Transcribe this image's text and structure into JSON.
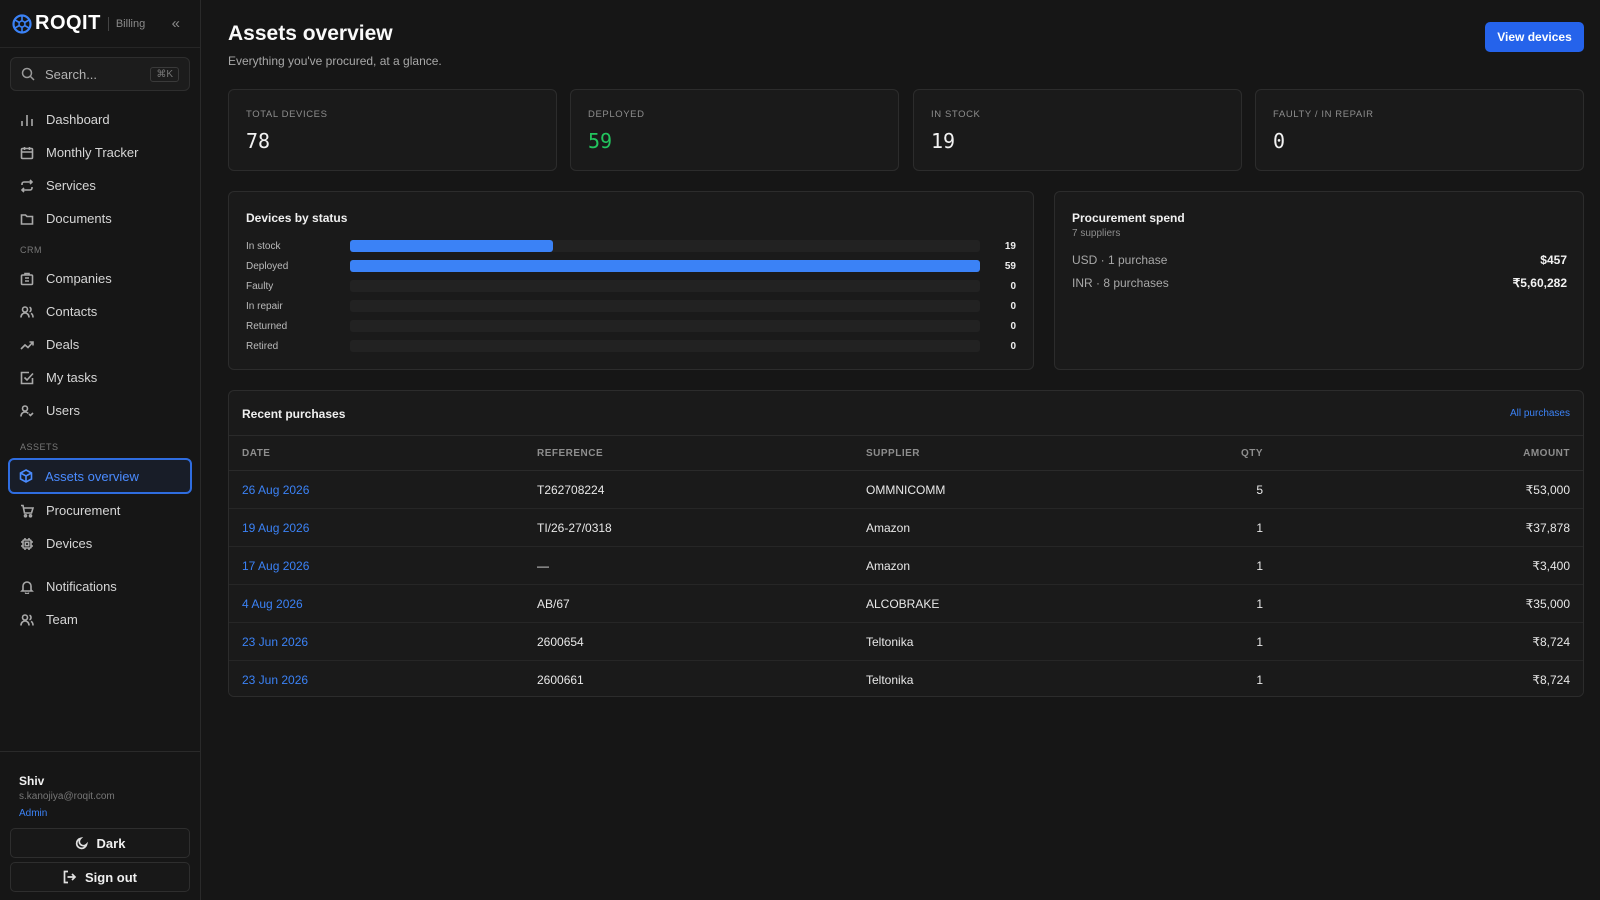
{
  "brand": {
    "name": "ROQIT",
    "product": "Billing",
    "collapse_icon": "chevrons-left-icon"
  },
  "search": {
    "placeholder": "Search...",
    "shortcut": "⌘K"
  },
  "nav": {
    "main": [
      {
        "label": "Dashboard",
        "icon": "bar-chart-icon"
      },
      {
        "label": "Monthly Tracker",
        "icon": "calendar-icon"
      },
      {
        "label": "Services",
        "icon": "repeat-icon"
      },
      {
        "label": "Documents",
        "icon": "folder-icon"
      }
    ],
    "crm_label": "CRM",
    "crm": [
      {
        "label": "Companies",
        "icon": "building-icon"
      },
      {
        "label": "Contacts",
        "icon": "users-icon"
      },
      {
        "label": "Deals",
        "icon": "trending-up-icon"
      },
      {
        "label": "My tasks",
        "icon": "check-square-icon"
      },
      {
        "label": "Users",
        "icon": "user-check-icon"
      }
    ],
    "assets_label": "ASSETS",
    "assets": [
      {
        "label": "Assets overview",
        "icon": "box-icon",
        "active": true
      },
      {
        "label": "Procurement",
        "icon": "cart-icon"
      },
      {
        "label": "Devices",
        "icon": "cpu-icon"
      }
    ],
    "extra": [
      {
        "label": "Notifications",
        "icon": "bell-icon"
      },
      {
        "label": "Team",
        "icon": "users-icon"
      }
    ]
  },
  "user": {
    "name": "Shiv",
    "email": "s.kanojiya@roqit.com",
    "role": "Admin"
  },
  "theme_button": "Dark",
  "signout_button": "Sign out",
  "page": {
    "title": "Assets overview",
    "subtitle": "Everything you've procured, at a glance.",
    "primary_action": "View devices"
  },
  "stats": [
    {
      "label": "TOTAL DEVICES",
      "value": "78",
      "color": "#f2f2f2"
    },
    {
      "label": "DEPLOYED",
      "value": "59",
      "color": "#22c55e"
    },
    {
      "label": "IN STOCK",
      "value": "19",
      "color": "#f2f2f2"
    },
    {
      "label": "FAULTY / IN REPAIR",
      "value": "0",
      "color": "#f2f2f2"
    }
  ],
  "status": {
    "title": "Devices by status",
    "max": 59,
    "rows": [
      {
        "label": "In stock",
        "count": 19
      },
      {
        "label": "Deployed",
        "count": 59
      },
      {
        "label": "Faulty",
        "count": 0
      },
      {
        "label": "In repair",
        "count": 0
      },
      {
        "label": "Returned",
        "count": 0
      },
      {
        "label": "Retired",
        "count": 0
      }
    ],
    "bar_color": "#3b82f6"
  },
  "spend": {
    "title": "Procurement spend",
    "subtitle": "7 suppliers",
    "rows": [
      {
        "label": "USD · 1 purchase",
        "amount": "$457"
      },
      {
        "label": "INR · 8 purchases",
        "amount": "₹5,60,282"
      }
    ]
  },
  "purchases": {
    "title": "Recent purchases",
    "link": "All purchases",
    "columns": [
      "DATE",
      "REFERENCE",
      "SUPPLIER",
      "QTY",
      "AMOUNT"
    ],
    "rows": [
      {
        "date": "26 Aug 2026",
        "reference": "T262708224",
        "supplier": "OMMNICOMM",
        "qty": "5",
        "amount": "₹53,000"
      },
      {
        "date": "19 Aug 2026",
        "reference": "TI/26-27/0318",
        "supplier": "Amazon",
        "qty": "1",
        "amount": "₹37,878"
      },
      {
        "date": "17 Aug 2026",
        "reference": "—",
        "supplier": "Amazon",
        "qty": "1",
        "amount": "₹3,400"
      },
      {
        "date": "4 Aug 2026",
        "reference": "AB/67",
        "supplier": "ALCOBRAKE",
        "qty": "1",
        "amount": "₹35,000"
      },
      {
        "date": "23 Jun 2026",
        "reference": "2600654",
        "supplier": "Teltonika",
        "qty": "1",
        "amount": "₹8,724"
      },
      {
        "date": "23 Jun 2026",
        "reference": "2600661",
        "supplier": "Teltonika",
        "qty": "1",
        "amount": "₹8,724"
      }
    ]
  },
  "accent": "#3b82f6"
}
